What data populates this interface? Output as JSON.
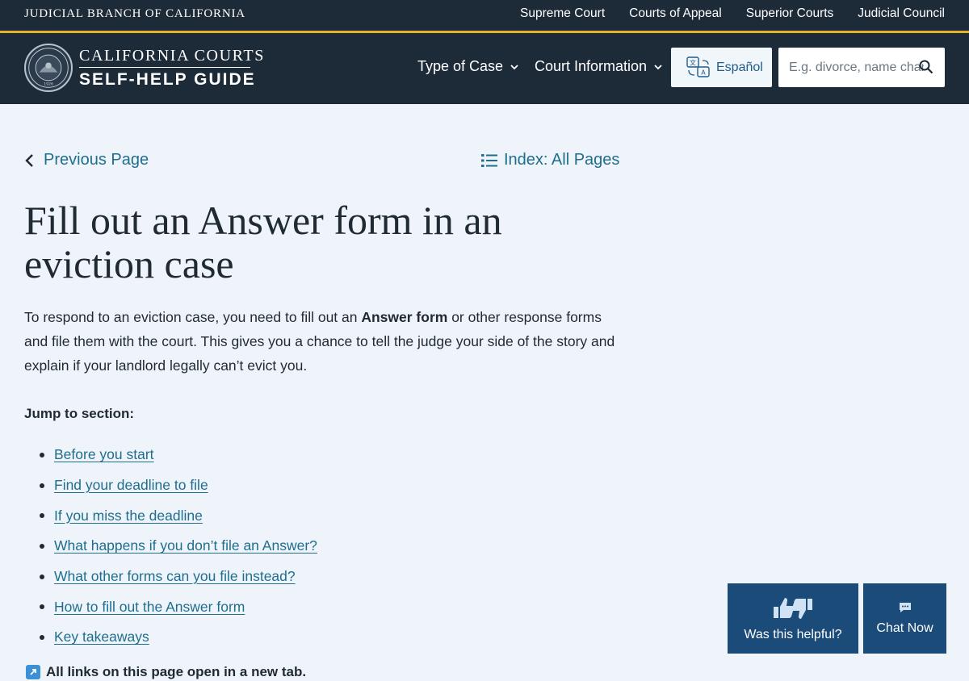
{
  "topbar": {
    "branch": "JUDICIAL BRANCH OF CALIFORNIA",
    "links": [
      "Supreme Court",
      "Courts of Appeal",
      "Superior Courts",
      "Judicial Council"
    ]
  },
  "header": {
    "brand_line1": "CALIFORNIA COURTS",
    "brand_line2": "SELF-HELP GUIDE",
    "nav": [
      "Type of Case",
      "Court Information"
    ],
    "language": "Español",
    "search_placeholder": "E.g. divorce, name change,",
    "seal_text": "JUDICIAL COUNCIL OF CALIFORNIA 1926"
  },
  "page": {
    "previous": "Previous Page",
    "index": "Index: All Pages",
    "title": "Fill out an Answer form in an eviction case",
    "intro_before": "To respond to an eviction case, you need to fill out an ",
    "intro_bold": "Answer form",
    "intro_after": " or other response forms and file them with the court. This gives you a chance to tell the judge your side of the story and explain if your landlord legally can’t evict you.",
    "jump_label": "Jump to section:",
    "sections": [
      "Before you start",
      "Find your deadline to file",
      "If you miss the deadline",
      "What happens if you don’t file an Answer?",
      "What other forms can you file instead?",
      "How to fill out the Answer form",
      "Key takeaways"
    ],
    "new_tab_note": "All links on this page open in a new tab."
  },
  "widgets": {
    "helpful": "Was this helpful?",
    "chat": "Chat Now"
  },
  "colors": {
    "header_bg": "#1d2a38",
    "accent_gold": "#e6b12a",
    "link": "#1f6e8e",
    "widget_bg": "#1b4b79",
    "page_bg": "#eef4fa"
  }
}
